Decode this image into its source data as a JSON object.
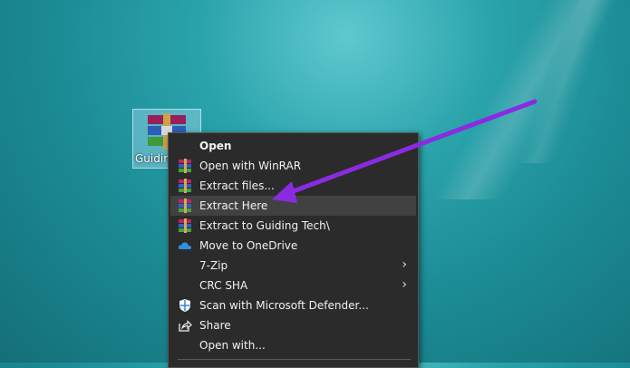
{
  "desktop": {
    "icon_label": "Guiding Tech",
    "icon_label_visible": "Guidin"
  },
  "menu": {
    "items": [
      {
        "label": "Open",
        "icon": "none",
        "bold": true
      },
      {
        "label": "Open with WinRAR",
        "icon": "winrar-icon"
      },
      {
        "label": "Extract files...",
        "icon": "winrar-icon"
      },
      {
        "label": "Extract Here",
        "icon": "winrar-icon",
        "highlighted": true
      },
      {
        "label": "Extract to Guiding Tech\\",
        "icon": "winrar-icon"
      },
      {
        "label": "Move to OneDrive",
        "icon": "onedrive-cloud-icon"
      },
      {
        "label": "7-Zip",
        "icon": "none",
        "submenu": true
      },
      {
        "label": "CRC SHA",
        "icon": "none",
        "submenu": true
      },
      {
        "label": "Scan with Microsoft Defender...",
        "icon": "defender-shield-icon"
      },
      {
        "label": "Share",
        "icon": "share-icon"
      },
      {
        "label": "Open with...",
        "icon": "none"
      }
    ],
    "submenu_glyph": "›"
  },
  "annotation": {
    "arrow_color": "#8a2be2"
  }
}
